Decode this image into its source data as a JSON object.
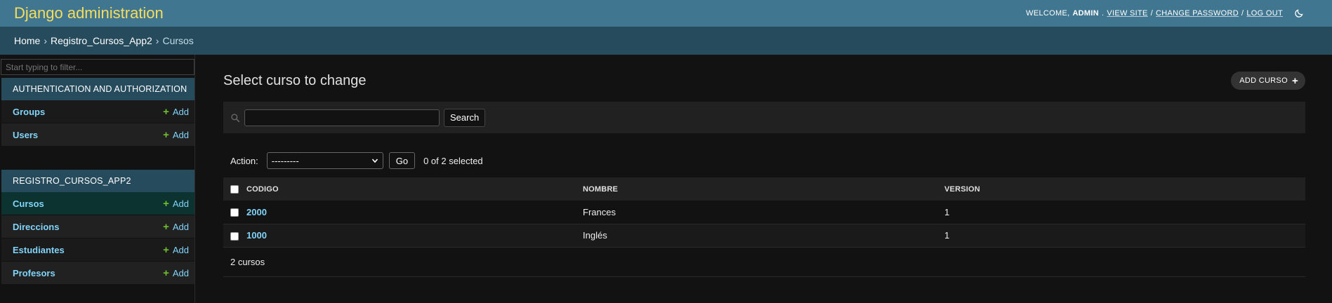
{
  "header": {
    "brand": "Django administration",
    "welcome": "WELCOME,",
    "username": "ADMIN",
    "period": ".",
    "view_site": "VIEW SITE",
    "change_password": "CHANGE PASSWORD",
    "log_out": "LOG OUT",
    "separator": "/"
  },
  "breadcrumbs": {
    "home": "Home",
    "app": "Registro_Cursos_App2",
    "current": "Cursos",
    "separator": "›"
  },
  "sidebar": {
    "filter_placeholder": "Start typing to filter...",
    "modules": [
      {
        "caption": "AUTHENTICATION AND AUTHORIZATION",
        "rows": [
          {
            "name": "Groups",
            "add": "Add"
          },
          {
            "name": "Users",
            "add": "Add"
          }
        ]
      },
      {
        "caption": "REGISTRO_CURSOS_APP2",
        "rows": [
          {
            "name": "Cursos",
            "add": "Add"
          },
          {
            "name": "Direccions",
            "add": "Add"
          },
          {
            "name": "Estudiantes",
            "add": "Add"
          },
          {
            "name": "Profesors",
            "add": "Add"
          }
        ]
      }
    ]
  },
  "content": {
    "title": "Select curso to change",
    "add_button": "ADD CURSO",
    "search_button": "Search",
    "search_value": "",
    "action_label": "Action:",
    "action_selected": "---------",
    "go_button": "Go",
    "counter": "0 of 2 selected",
    "columns": [
      "CODIGO",
      "NOMBRE",
      "VERSION"
    ],
    "rows": [
      {
        "codigo": "2000",
        "nombre": "Frances",
        "version": "1"
      },
      {
        "codigo": "1000",
        "nombre": "Inglés",
        "version": "1"
      }
    ],
    "paginator": "2 cursos"
  },
  "colors": {
    "header_bg": "#417690",
    "brand": "#f5dd5d",
    "breadcrumb_bg": "#264b5d",
    "link": "#81d4fa",
    "add_plus": "#70bf2b",
    "page_bg": "#121212"
  }
}
